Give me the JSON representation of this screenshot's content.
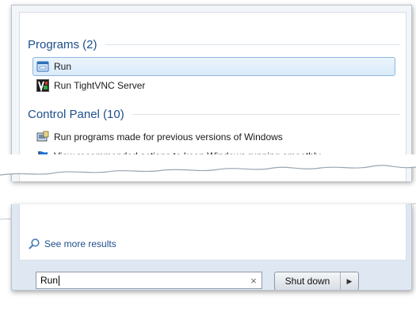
{
  "programs": {
    "header": "Programs (2)",
    "items": [
      {
        "label": "Run",
        "icon": "run-window-icon",
        "selected": true
      },
      {
        "label": "Run TightVNC Server",
        "icon": "tightvnc-icon",
        "selected": false
      }
    ]
  },
  "control_panel": {
    "header": "Control Panel (10)",
    "items": [
      {
        "label": "Run programs made for previous versions of Windows",
        "icon": "compatibility-icon"
      },
      {
        "label": "View recommended actions to keep Windows running smoothly",
        "icon": "action-center-flag-icon"
      }
    ]
  },
  "footer": {
    "see_more": "See more results",
    "search_value": "Run",
    "clear_glyph": "×",
    "shutdown_label": "Shut down",
    "shutdown_arrow": "▶"
  },
  "colors": {
    "header_text": "#1e4f8c",
    "selection_border": "#8cb6e0",
    "selection_fill": "#dcecfc"
  }
}
